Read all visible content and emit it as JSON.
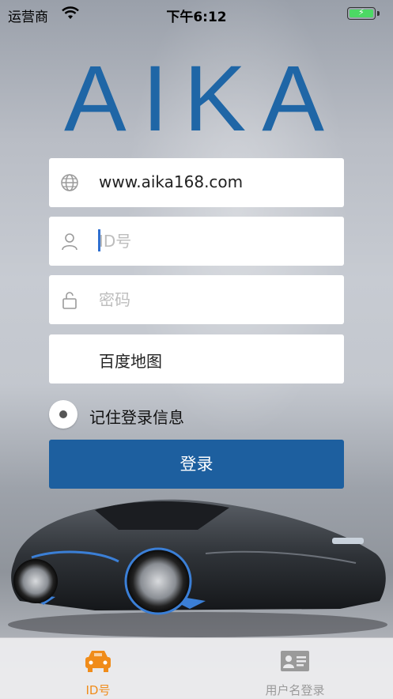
{
  "status_bar": {
    "carrier": "运营商",
    "time": "下午6:12"
  },
  "logo": "AIKA",
  "form": {
    "server": {
      "value": "www.aika168.com",
      "icon": "globe-icon"
    },
    "id": {
      "placeholder": "ID号",
      "icon": "user-icon"
    },
    "password": {
      "placeholder": "密码",
      "icon": "lock-icon"
    },
    "map": {
      "value": "百度地图"
    },
    "remember_label": "记住登录信息",
    "login_label": "登录"
  },
  "tabs": [
    {
      "label": "ID号",
      "icon": "car-icon",
      "active": true
    },
    {
      "label": "用户名登录",
      "icon": "id-card-icon",
      "active": false
    }
  ],
  "colors": {
    "brand": "#1f66a6",
    "button": "#1d5f9f",
    "tab_active": "#f08c1a",
    "tab_inactive": "#9a9a9a"
  }
}
